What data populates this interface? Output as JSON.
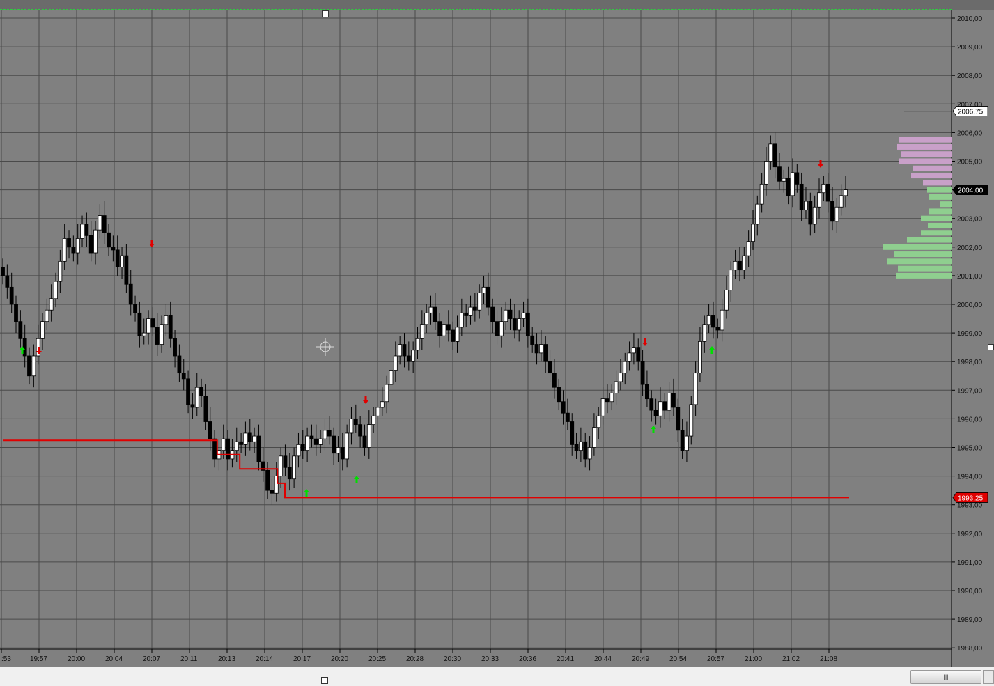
{
  "chart_data": {
    "type": "candlestick",
    "yaxis": {
      "ticks": [
        "2010,00",
        "2009,00",
        "2008,00",
        "2007,00",
        "2006,00",
        "2005,00",
        "2004,00",
        "2003,00",
        "2002,00",
        "2001,00",
        "2000,00",
        "1999,00",
        "1998,00",
        "1997,00",
        "1996,00",
        "1995,00",
        "1994,00",
        "1993,00",
        "1992,00",
        "1991,00",
        "1990,00",
        "1989,00",
        "1988,00"
      ],
      "range": [
        1988,
        2010.5
      ]
    },
    "xaxis": {
      "ticks": [
        ":53",
        "19:57",
        "20:00",
        "20:04",
        "20:07",
        "20:11",
        "20:13",
        "20:14",
        "20:17",
        "20:20",
        "20:25",
        "20:28",
        "20:30",
        "20:33",
        "20:36",
        "20:41",
        "20:44",
        "20:49",
        "20:54",
        "20:57",
        "21:00",
        "21:02",
        "21:08"
      ]
    },
    "price_labels": [
      {
        "name": "upper-level",
        "value": "2006,75",
        "color": "#ffffff"
      },
      {
        "name": "last-price",
        "value": "2004,00",
        "color": "#000000"
      },
      {
        "name": "stop-level",
        "value": "1993,25",
        "color": "#e00000"
      }
    ],
    "stop_line": [
      {
        "x": 0,
        "y": 1995.25
      },
      {
        "x": 5.7,
        "y": 1995.25
      },
      {
        "x": 5.7,
        "y": 1994.75
      },
      {
        "x": 6.3,
        "y": 1994.75
      },
      {
        "x": 6.3,
        "y": 1994.25
      },
      {
        "x": 7.3,
        "y": 1994.25
      },
      {
        "x": 7.3,
        "y": 1993.75
      },
      {
        "x": 7.5,
        "y": 1993.75
      },
      {
        "x": 7.5,
        "y": 1993.25
      },
      {
        "x": 22.5,
        "y": 1993.25
      }
    ],
    "closes": [
      2001.0,
      2000.6,
      2000.0,
      1999.4,
      1998.8,
      1998.2,
      1997.5,
      1998.2,
      1998.8,
      1999.4,
      1999.8,
      2000.2,
      2000.8,
      2001.5,
      2002.3,
      2002.0,
      2001.8,
      2002.3,
      2002.8,
      2002.4,
      2001.8,
      2002.6,
      2003.1,
      2002.5,
      2002.0,
      2001.9,
      2001.3,
      2001.7,
      2000.7,
      2000.0,
      1999.7,
      1998.9,
      1999.0,
      1999.5,
      1999.2,
      1998.6,
      1999.3,
      1999.6,
      1998.8,
      1998.2,
      1997.6,
      1997.4,
      1996.5,
      1996.4,
      1997.1,
      1996.8,
      1995.9,
      1995.3,
      1994.6,
      1994.9,
      1995.3,
      1994.6,
      1994.9,
      1995.2,
      1995.1,
      1995.5,
      1995.2,
      1995.4,
      1994.5,
      1994.2,
      1993.5,
      1993.4,
      1994.0,
      1994.7,
      1994.3,
      1993.9,
      1994.7,
      1995.1,
      1994.9,
      1995.4,
      1995.3,
      1995.1,
      1995.3,
      1995.6,
      1995.4,
      1994.8,
      1995.0,
      1994.6,
      1995.5,
      1996.0,
      1995.8,
      1995.4,
      1995.0,
      1995.8,
      1996.1,
      1996.4,
      1996.6,
      1997.2,
      1997.7,
      1998.2,
      1998.6,
      1998.2,
      1998.0,
      1998.4,
      1998.8,
      1999.3,
      1999.7,
      1999.9,
      1999.4,
      1998.9,
      1999.3,
      1999.1,
      1998.7,
      1999.2,
      1999.7,
      1999.6,
      1999.9,
      1999.8,
      2000.4,
      2000.6,
      1999.9,
      1999.4,
      1998.9,
      1999.4,
      1999.8,
      1999.5,
      1999.1,
      1999.5,
      1999.7,
      1998.9,
      1998.6,
      1998.3,
      1998.6,
      1998.0,
      1997.6,
      1997.1,
      1996.6,
      1996.2,
      1995.9,
      1995.1,
      1994.9,
      1995.2,
      1994.6,
      1995.0,
      1995.7,
      1996.1,
      1996.7,
      1996.6,
      1996.9,
      1997.3,
      1997.6,
      1998.0,
      1998.3,
      1998.5,
      1998.0,
      1997.2,
      1996.7,
      1996.3,
      1996.1,
      1996.6,
      1996.3,
      1996.9,
      1996.4,
      1995.6,
      1994.9,
      1995.4,
      1996.5,
      1997.6,
      1998.7,
      1999.3,
      1999.6,
      1999.2,
      1999.1,
      1999.8,
      2000.5,
      2001.2,
      2001.5,
      2001.2,
      2001.7,
      2002.2,
      2002.8,
      2003.5,
      2004.2,
      2005.0,
      2005.6,
      2004.8,
      2004.3,
      2004.4,
      2003.8,
      2004.6,
      2004.2,
      2003.3,
      2003.6,
      2002.8,
      2003.4,
      2003.9,
      2004.2,
      2003.6,
      2002.9,
      2003.4,
      2003.8,
      2004.0
    ]
  },
  "scrollbar": {
    "grip": "|||"
  }
}
